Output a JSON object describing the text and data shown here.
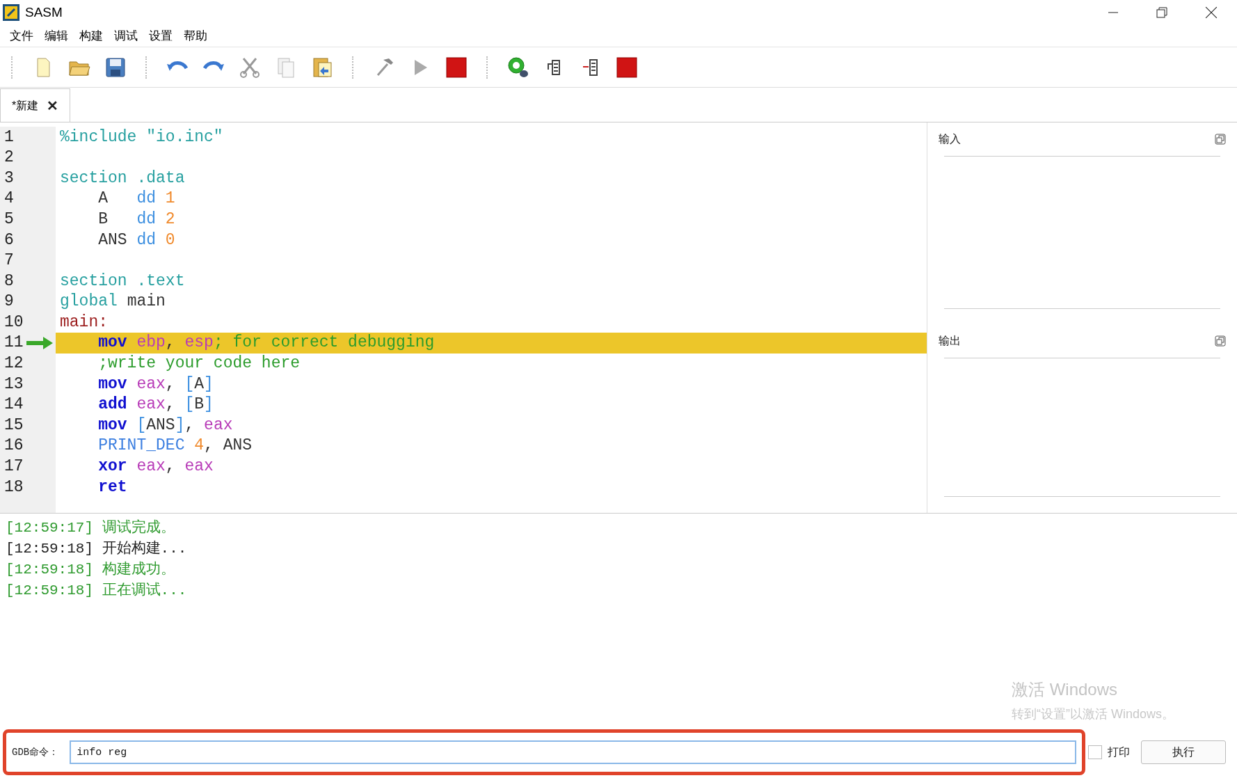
{
  "window": {
    "title": "SASM"
  },
  "menu": [
    "文件",
    "编辑",
    "构建",
    "调试",
    "设置",
    "帮助"
  ],
  "tabs": [
    {
      "label": "*新建",
      "selected": true,
      "close": "✕"
    }
  ],
  "editor": {
    "lines": [
      {
        "number": "1",
        "current": false,
        "tokens": [
          {
            "text": "%include \"io.inc\"",
            "kind": "directive"
          }
        ]
      },
      {
        "number": "2",
        "current": false
      },
      {
        "number": "3",
        "current": false,
        "tokens": [
          {
            "text": "section .data",
            "kind": "directive"
          }
        ]
      },
      {
        "number": "4",
        "current": false,
        "tokens": [
          {
            "text": "    A   ",
            "kind": "plain"
          },
          {
            "text": "dd ",
            "kind": "data"
          },
          {
            "text": "1",
            "kind": "number"
          }
        ]
      },
      {
        "number": "5",
        "current": false,
        "tokens": [
          {
            "text": "    B   ",
            "kind": "plain"
          },
          {
            "text": "dd ",
            "kind": "data"
          },
          {
            "text": "2",
            "kind": "number"
          }
        ]
      },
      {
        "number": "6",
        "current": false,
        "tokens": [
          {
            "text": "    ANS ",
            "kind": "plain"
          },
          {
            "text": "dd ",
            "kind": "data"
          },
          {
            "text": "0",
            "kind": "number"
          }
        ]
      },
      {
        "number": "7",
        "current": false
      },
      {
        "number": "8",
        "current": false,
        "tokens": [
          {
            "text": "section .text",
            "kind": "directive"
          }
        ]
      },
      {
        "number": "9",
        "current": false,
        "tokens": [
          {
            "text": "global ",
            "kind": "directive"
          },
          {
            "text": "main",
            "kind": "plain"
          }
        ]
      },
      {
        "number": "10",
        "current": false,
        "tokens": [
          {
            "text": "main:",
            "kind": "label"
          }
        ]
      },
      {
        "number": "11",
        "current": true,
        "tokens": [
          {
            "text": "    mov ",
            "kind": "keyword"
          },
          {
            "text": "ebp",
            "kind": "register"
          },
          {
            "text": ", ",
            "kind": "plain"
          },
          {
            "text": "esp",
            "kind": "register"
          },
          {
            "text": "; for correct debugging",
            "kind": "comment"
          }
        ]
      },
      {
        "number": "12",
        "current": false,
        "tokens": [
          {
            "text": "    ;write your code here",
            "kind": "comment"
          }
        ]
      },
      {
        "number": "13",
        "current": false,
        "tokens": [
          {
            "text": "    mov ",
            "kind": "keyword"
          },
          {
            "text": "eax",
            "kind": "register"
          },
          {
            "text": ", ",
            "kind": "plain"
          },
          {
            "text": "[",
            "kind": "data"
          },
          {
            "text": "A",
            "kind": "plain"
          },
          {
            "text": "]",
            "kind": "data"
          }
        ]
      },
      {
        "number": "14",
        "current": false,
        "tokens": [
          {
            "text": "    add ",
            "kind": "keyword"
          },
          {
            "text": "eax",
            "kind": "register"
          },
          {
            "text": ", ",
            "kind": "plain"
          },
          {
            "text": "[",
            "kind": "data"
          },
          {
            "text": "B",
            "kind": "plain"
          },
          {
            "text": "]",
            "kind": "data"
          }
        ]
      },
      {
        "number": "15",
        "current": false,
        "tokens": [
          {
            "text": "    mov ",
            "kind": "keyword"
          },
          {
            "text": "[",
            "kind": "data"
          },
          {
            "text": "ANS",
            "kind": "plain"
          },
          {
            "text": "]",
            "kind": "data"
          },
          {
            "text": ", ",
            "kind": "plain"
          },
          {
            "text": "eax",
            "kind": "register"
          }
        ]
      },
      {
        "number": "16",
        "current": false,
        "tokens": [
          {
            "text": "    PRINT_DEC ",
            "kind": "macro"
          },
          {
            "text": "4",
            "kind": "number"
          },
          {
            "text": ", ANS",
            "kind": "plain"
          }
        ]
      },
      {
        "number": "17",
        "current": false,
        "tokens": [
          {
            "text": "    xor ",
            "kind": "keyword"
          },
          {
            "text": "eax",
            "kind": "register"
          },
          {
            "text": ", ",
            "kind": "plain"
          },
          {
            "text": "eax",
            "kind": "register"
          }
        ]
      },
      {
        "number": "18",
        "current": false,
        "tokens": [
          {
            "text": "    ret",
            "kind": "keyword"
          }
        ]
      }
    ]
  },
  "side_panels": [
    {
      "title": "输入"
    },
    {
      "title": "输出"
    }
  ],
  "log": [
    {
      "text": "[12:59:17] 调试完成。",
      "color": "#2e9a2e"
    },
    {
      "text": "[12:59:18] 开始构建...",
      "color": "#222222"
    },
    {
      "text": "[12:59:18] 构建成功。",
      "color": "#2e9a2e"
    },
    {
      "text": "[12:59:18] 正在调试...",
      "color": "#2e9a2e"
    }
  ],
  "gdb": {
    "label": "GDB命令：",
    "value": "info reg",
    "highlighted": true,
    "print": {
      "label": "打印",
      "checked": false
    },
    "run_button": "执行"
  },
  "activation": {
    "title": "激活 Windows",
    "hint": "转到“设置”以激活 Windows。"
  }
}
